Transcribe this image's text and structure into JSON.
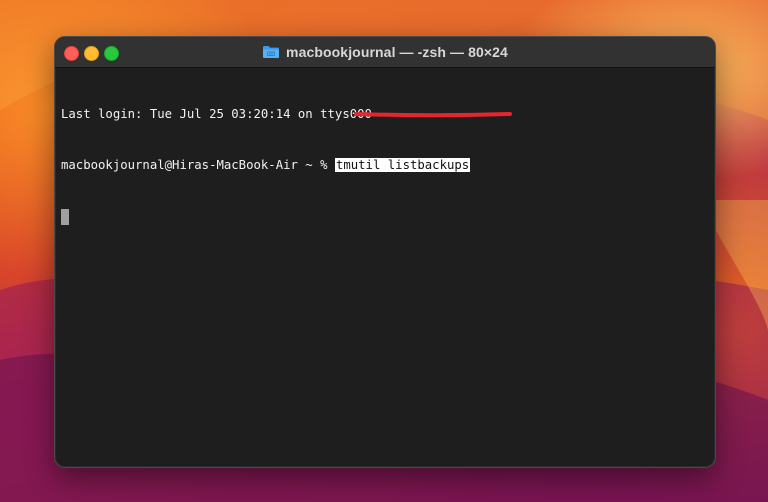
{
  "window": {
    "title": "macbookjournal — -zsh — 80×24",
    "title_icon": "folder-icon",
    "traffic_lights": {
      "close": "#ff5f57",
      "minimize": "#febc2e",
      "zoom": "#28c840"
    }
  },
  "terminal": {
    "last_login": "Last login: Tue Jul 25 03:20:14 on ttys000",
    "prompt": "macbookjournal@Hiras-MacBook-Air ~ % ",
    "command": "tmutil listbackups",
    "colors": {
      "background": "#1e1e1e",
      "text": "#f2f2f2",
      "annotation": "#e8252f"
    }
  }
}
